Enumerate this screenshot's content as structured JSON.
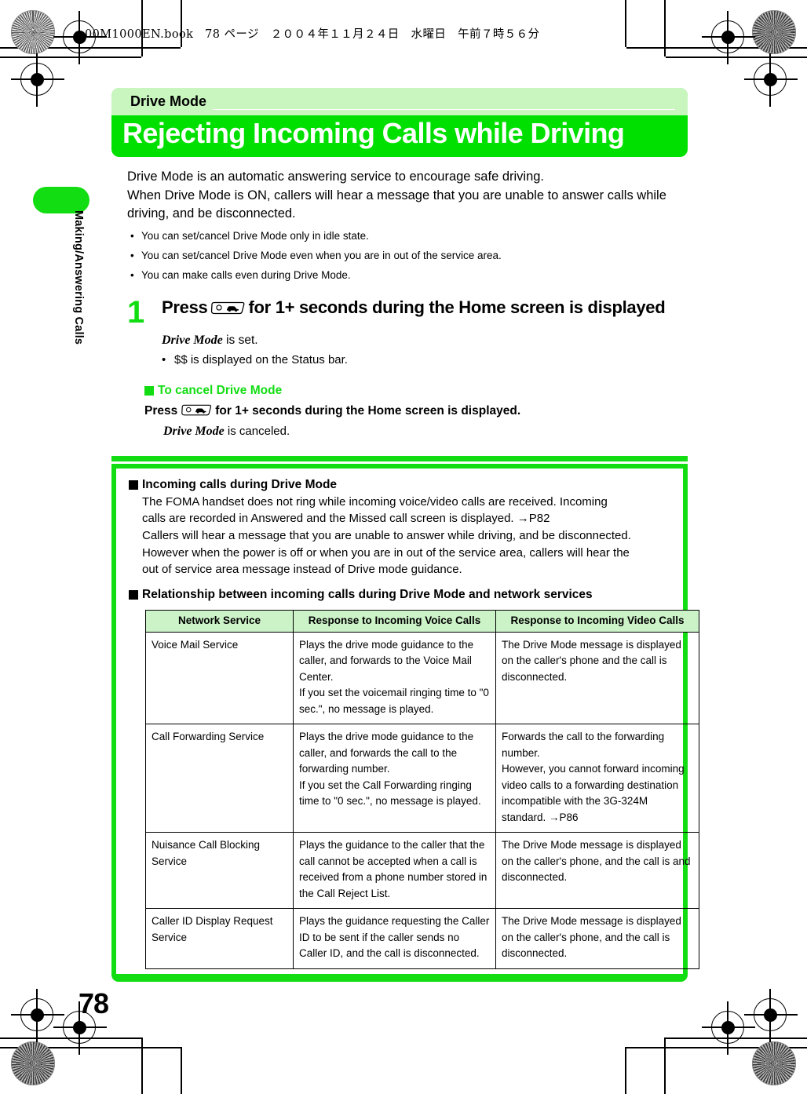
{
  "slug": "00M1000EN.book　78 ページ　２００４年１１月２４日　水曜日　午前７時５６分",
  "sidebar": {
    "chapter_label": "Making/Answering Calls"
  },
  "page_number": "78",
  "header": {
    "kicker": "Drive Mode",
    "title": "Rejecting Incoming Calls while Driving"
  },
  "intro": {
    "line1": "Drive Mode is an automatic answering service to encourage safe driving.",
    "line2": "When Drive Mode is ON, callers will hear a message that you are unable to answer calls while",
    "line3": "driving, and be disconnected.",
    "bullet_mark": "•",
    "bullets": [
      "You can set/cancel Drive Mode only in idle state.",
      "You can set/cancel Drive Mode even when you are in out of the service area.",
      "You can make calls even during Drive Mode."
    ]
  },
  "step": {
    "number": "1",
    "head_before_key": "Press",
    "key_icon_name": "drive-mode-key-icon",
    "head_after_key": "for 1+ seconds during the Home screen is displayed",
    "result_italic": "Drive Mode",
    "result_rest": " is set.",
    "sub_mark": "•",
    "sub_text": "$$ is displayed on the Status bar."
  },
  "cancel_section": {
    "heading": "To cancel Drive Mode",
    "line_before_key": "Press",
    "line_after_key": "for 1+ seconds during the Home screen is displayed.",
    "result_italic": "Drive Mode",
    "result_rest": " is canceled."
  },
  "notes": {
    "heading1": "Incoming calls during Drive Mode",
    "body1_line1": "The FOMA handset does not ring while incoming voice/video calls are received. Incoming",
    "body1_line2": "calls are recorded in Answered and the Missed call screen is displayed. →P82",
    "body1_line3": "Callers will hear a message that you are unable to answer while driving, and be disconnected.",
    "body1_line4": "However when the power is off or when you are in out of the service area, callers will hear the",
    "body1_line5": "out of service area message instead of Drive mode guidance.",
    "heading2": "Relationship between incoming calls during Drive Mode and network services"
  },
  "table": {
    "headers": [
      "Network Service",
      "Response to Incoming Voice Calls",
      "Response to Incoming Video Calls"
    ],
    "rows": [
      {
        "service": "Voice Mail Service",
        "voice": "Plays the drive mode guidance to the caller, and forwards to the Voice Mail Center.\nIf you set the voicemail ringing time to \"0 sec.\", no message is played.",
        "video": "The Drive Mode message is displayed on the caller's phone and the call is disconnected."
      },
      {
        "service": "Call Forwarding Service",
        "voice": "Plays the drive mode guidance to the caller, and forwards the call to the forwarding number.\nIf you set the Call Forwarding ringing time to \"0 sec.\", no message is played.",
        "video": "Forwards the call to the forwarding number.\nHowever, you cannot forward incoming video calls to a forwarding destination incompatible with the 3G-324M standard. →P86"
      },
      {
        "service": "Nuisance Call Blocking Service",
        "voice": "Plays the guidance to the caller that the call cannot be accepted when a call is received from a phone number stored in the Call Reject List.",
        "video": "The Drive Mode message is displayed on the caller's phone, and the call is and disconnected."
      },
      {
        "service": "Caller ID Display Request Service",
        "voice": "Plays the guidance requesting the Caller ID to be sent if the caller sends no Caller ID, and the call is disconnected.",
        "video": "The Drive Mode message is displayed on the caller's phone, and the call is disconnected."
      }
    ]
  },
  "colors": {
    "accent_green": "#12dd12",
    "title_green": "#00e000",
    "kicker_green": "#c9f5bf",
    "table_header_green": "#ccf3c8"
  }
}
